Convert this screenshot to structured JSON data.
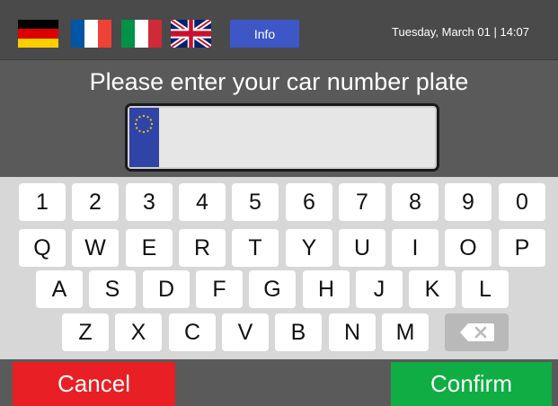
{
  "header": {
    "languages": [
      {
        "code": "de",
        "flag": "germany-flag"
      },
      {
        "code": "fr",
        "flag": "france-flag"
      },
      {
        "code": "it",
        "flag": "italy-flag"
      },
      {
        "code": "en",
        "flag": "uk-flag"
      }
    ],
    "info_label": "Info",
    "datetime": "Tuesday, March 01 | 14:07"
  },
  "prompt": "Please enter your car number plate",
  "plate": {
    "value": "",
    "band_icon": "eu-stars-icon"
  },
  "keyboard": {
    "rows": [
      [
        "1",
        "2",
        "3",
        "4",
        "5",
        "6",
        "7",
        "8",
        "9",
        "0"
      ],
      [
        "Q",
        "W",
        "E",
        "R",
        "T",
        "Y",
        "U",
        "I",
        "O",
        "P"
      ],
      [
        "A",
        "S",
        "D",
        "F",
        "G",
        "H",
        "J",
        "K",
        "L"
      ],
      [
        "Z",
        "X",
        "C",
        "V",
        "B",
        "N",
        "M"
      ]
    ],
    "backspace_icon": "backspace-icon"
  },
  "actions": {
    "cancel_label": "Cancel",
    "confirm_label": "Confirm"
  },
  "colors": {
    "header_bg": "#4a4a4a",
    "panel_bg": "#5a5a5a",
    "keyboard_bg": "#d7d7d7",
    "info_button": "#3d57c6",
    "cancel": "#e81f24",
    "confirm": "#0fad43",
    "eu_band": "#2f44a6",
    "eu_stars": "#f5d20a"
  }
}
